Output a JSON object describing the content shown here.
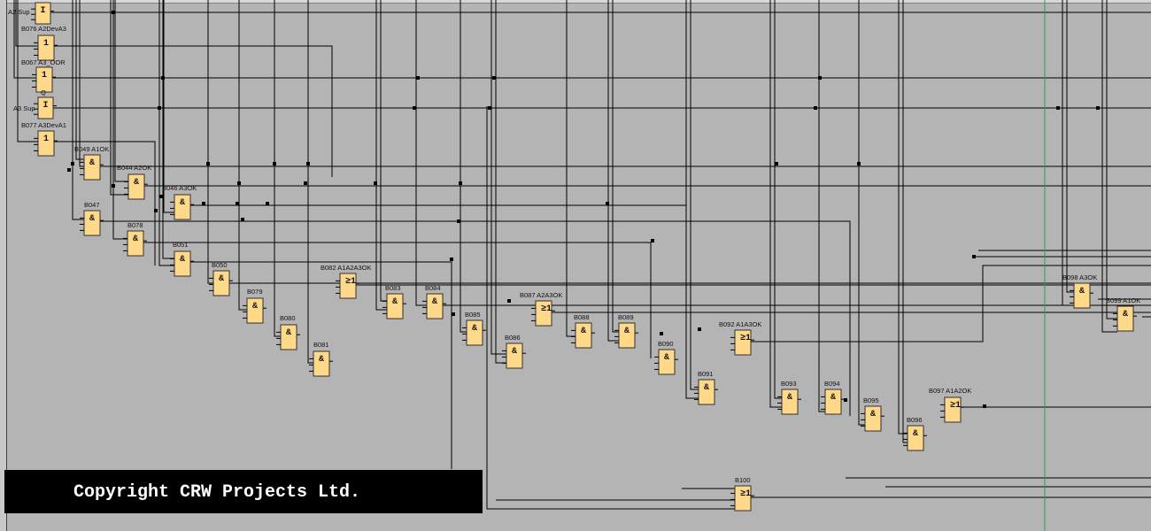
{
  "diagram": {
    "type": "function block diagram",
    "colors": {
      "background": "#b4b4b4",
      "block_fill": "#ffd98a",
      "wire": "#000000",
      "cursor_line": "#2ca050",
      "banner": "#000000"
    },
    "inputs": [
      {
        "label": "A2 Sup",
        "symbol": "I"
      },
      {
        "label": "A3 Sup",
        "symbol": "I"
      }
    ],
    "output_marker": "Q",
    "blocks": [
      {
        "id": "B076",
        "label": "B076 A2DevA3",
        "symbol": "1"
      },
      {
        "id": "B067",
        "label": "B067 A3_OOR",
        "symbol": "1"
      },
      {
        "id": "B077",
        "label": "B077 A3DevA1",
        "symbol": "1"
      },
      {
        "id": "B049",
        "label": "B049 A1OK",
        "symbol": "&"
      },
      {
        "id": "B044",
        "label": "B044 A2OK",
        "symbol": "&"
      },
      {
        "id": "B046",
        "label": "B046 A3OK",
        "symbol": "&"
      },
      {
        "id": "B047",
        "label": "B047",
        "symbol": "&"
      },
      {
        "id": "B078",
        "label": "B078",
        "symbol": "&"
      },
      {
        "id": "B051",
        "label": "B051",
        "symbol": "&"
      },
      {
        "id": "B050",
        "label": "B050",
        "symbol": "&"
      },
      {
        "id": "B079",
        "label": "B079",
        "symbol": "&"
      },
      {
        "id": "B080",
        "label": "B080",
        "symbol": "&"
      },
      {
        "id": "B081",
        "label": "B081",
        "symbol": "&"
      },
      {
        "id": "B082",
        "label": "B082 A1A2A3OK",
        "symbol": "≥1"
      },
      {
        "id": "B083",
        "label": "B083",
        "symbol": "&"
      },
      {
        "id": "B084",
        "label": "B084",
        "symbol": "&"
      },
      {
        "id": "B085",
        "label": "B085",
        "symbol": "&"
      },
      {
        "id": "B086",
        "label": "B086",
        "symbol": "&"
      },
      {
        "id": "B087",
        "label": "B087 A2A3OK",
        "symbol": "≥1"
      },
      {
        "id": "B088",
        "label": "B088",
        "symbol": "&"
      },
      {
        "id": "B089",
        "label": "B089",
        "symbol": "&"
      },
      {
        "id": "B090",
        "label": "B090",
        "symbol": "&"
      },
      {
        "id": "B091",
        "label": "B091",
        "symbol": "&"
      },
      {
        "id": "B092",
        "label": "B092 A1A3OK",
        "symbol": "≥1"
      },
      {
        "id": "B093",
        "label": "B093",
        "symbol": "&"
      },
      {
        "id": "B094",
        "label": "B094",
        "symbol": "&"
      },
      {
        "id": "B095",
        "label": "B095",
        "symbol": "&"
      },
      {
        "id": "B096",
        "label": "B096",
        "symbol": "&"
      },
      {
        "id": "B097",
        "label": "B097 A1A2OK",
        "symbol": "≥1"
      },
      {
        "id": "B098",
        "label": "B098 A3OK",
        "symbol": "&"
      },
      {
        "id": "B099",
        "label": "B099 A1OK",
        "symbol": "&"
      },
      {
        "id": "B100",
        "label": "B100",
        "symbol": "≥1"
      }
    ]
  },
  "banner": {
    "text": "Copyright CRW Projects Ltd."
  }
}
